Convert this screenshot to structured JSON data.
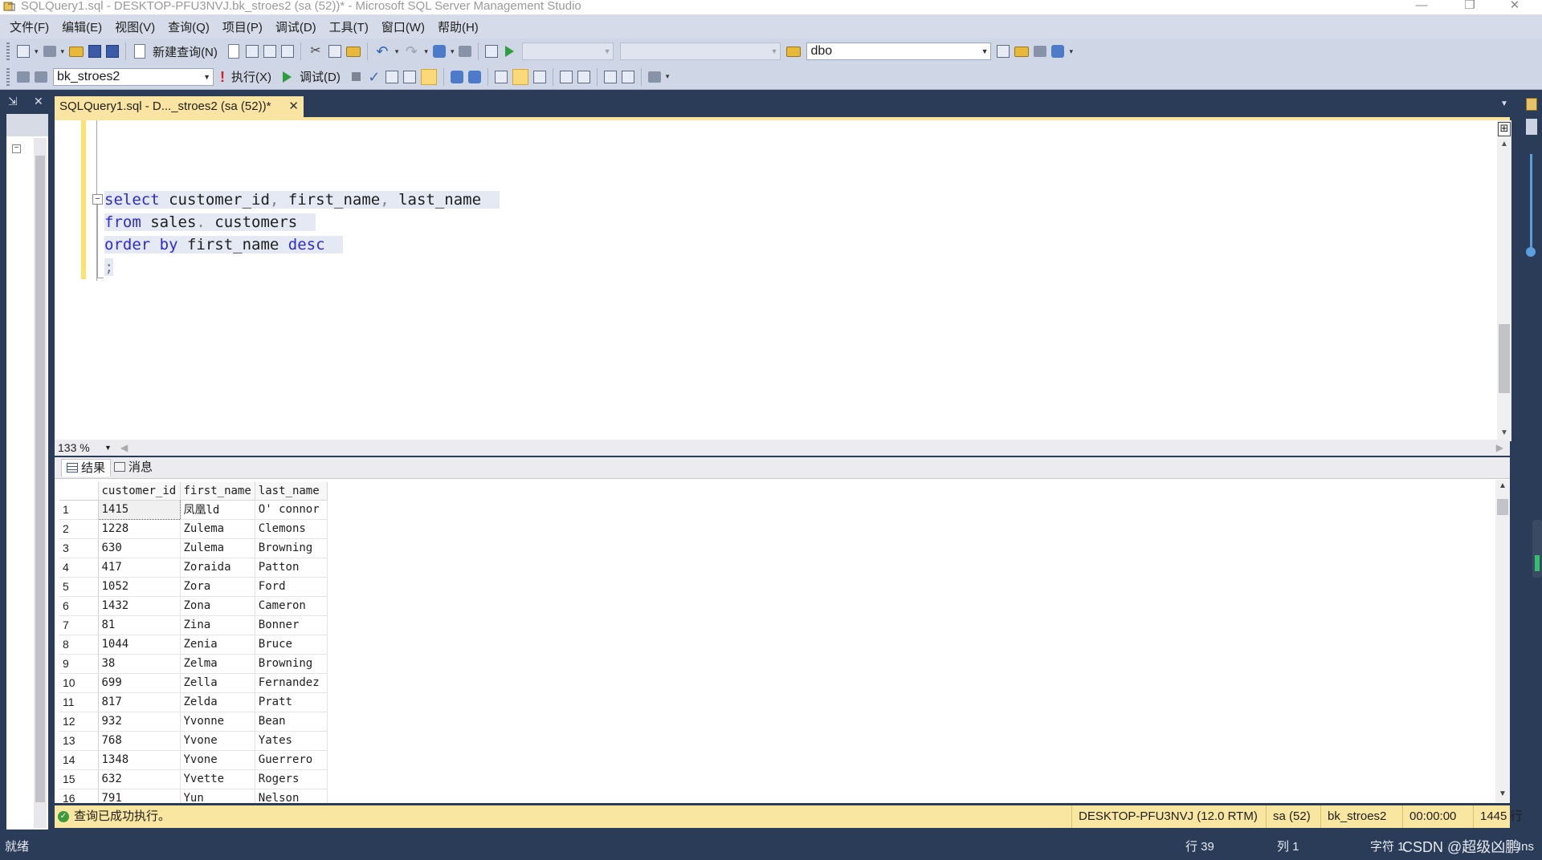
{
  "window": {
    "title": "SQLQuery1.sql - DESKTOP-PFU3NVJ.bk_stroes2 (sa (52))* - Microsoft SQL Server Management Studio",
    "min_glyph": "—",
    "restore_glyph": "❐",
    "close_glyph": "✕"
  },
  "menu": [
    {
      "label": "文件(F)"
    },
    {
      "label": "编辑(E)"
    },
    {
      "label": "视图(V)"
    },
    {
      "label": "查询(Q)"
    },
    {
      "label": "项目(P)"
    },
    {
      "label": "调试(D)"
    },
    {
      "label": "工具(T)"
    },
    {
      "label": "窗口(W)"
    },
    {
      "label": "帮助(H)"
    }
  ],
  "toolbar1": {
    "new_query_label": "新建查询(N)",
    "schema_combo_value": "dbo"
  },
  "toolbar2": {
    "database_combo_value": "bk_stroes2",
    "execute_label": "执行(X)",
    "debug_label": "调试(D)"
  },
  "document_tab": {
    "label": "SQLQuery1.sql - D..._stroes2 (sa (52))*",
    "close_glyph": "✕"
  },
  "editor": {
    "lines": [
      [
        "select",
        " customer_id",
        ",",
        " first_name",
        ",",
        " last_name"
      ],
      [
        "from",
        " sales",
        ".",
        " customers"
      ],
      [
        "order by",
        " first_name",
        " desc"
      ],
      [
        ";"
      ]
    ],
    "zoom": "133 %"
  },
  "result_tabs": {
    "results_label": "结果",
    "messages_label": "消息"
  },
  "results": {
    "columns": [
      "customer_id",
      "first_name",
      "last_name"
    ],
    "rows": [
      {
        "n": "1",
        "customer_id": "1415",
        "first_name": "凤凰ld",
        "last_name": "O' connor"
      },
      {
        "n": "2",
        "customer_id": "1228",
        "first_name": "Zulema",
        "last_name": "Clemons"
      },
      {
        "n": "3",
        "customer_id": "630",
        "first_name": "Zulema",
        "last_name": "Browning"
      },
      {
        "n": "4",
        "customer_id": "417",
        "first_name": "Zoraida",
        "last_name": "Patton"
      },
      {
        "n": "5",
        "customer_id": "1052",
        "first_name": "Zora",
        "last_name": "Ford"
      },
      {
        "n": "6",
        "customer_id": "1432",
        "first_name": "Zona",
        "last_name": "Cameron"
      },
      {
        "n": "7",
        "customer_id": "81",
        "first_name": "Zina",
        "last_name": "Bonner"
      },
      {
        "n": "8",
        "customer_id": "1044",
        "first_name": "Zenia",
        "last_name": "Bruce"
      },
      {
        "n": "9",
        "customer_id": "38",
        "first_name": "Zelma",
        "last_name": "Browning"
      },
      {
        "n": "10",
        "customer_id": "699",
        "first_name": "Zella",
        "last_name": "Fernandez"
      },
      {
        "n": "11",
        "customer_id": "817",
        "first_name": "Zelda",
        "last_name": "Pratt"
      },
      {
        "n": "12",
        "customer_id": "932",
        "first_name": "Yvonne",
        "last_name": "Bean"
      },
      {
        "n": "13",
        "customer_id": "768",
        "first_name": "Yvone",
        "last_name": "Yates"
      },
      {
        "n": "14",
        "customer_id": "1348",
        "first_name": "Yvone",
        "last_name": "Guerrero"
      },
      {
        "n": "15",
        "customer_id": "632",
        "first_name": "Yvette",
        "last_name": "Rogers"
      },
      {
        "n": "16",
        "customer_id": "791",
        "first_name": "Yun",
        "last_name": "Nelson"
      }
    ]
  },
  "query_status": {
    "message": "查询已成功执行。",
    "server": "DESKTOP-PFU3NVJ (12.0 RTM)",
    "user": "sa (52)",
    "database": "bk_stroes2",
    "elapsed": "00:00:00",
    "row_count": "1445 行"
  },
  "statusbar": {
    "ready": "就绪",
    "line": "行 39",
    "column": "列 1",
    "char": "字符 1",
    "ins": "Ins",
    "watermark": "CSDN @超级凶鹏"
  },
  "colors": {
    "chrome_dark": "#2b3c59",
    "tab_active": "#f9e4a2",
    "status_yellow": "#f9e7a1",
    "keyword_blue": "#2a2ad8"
  }
}
